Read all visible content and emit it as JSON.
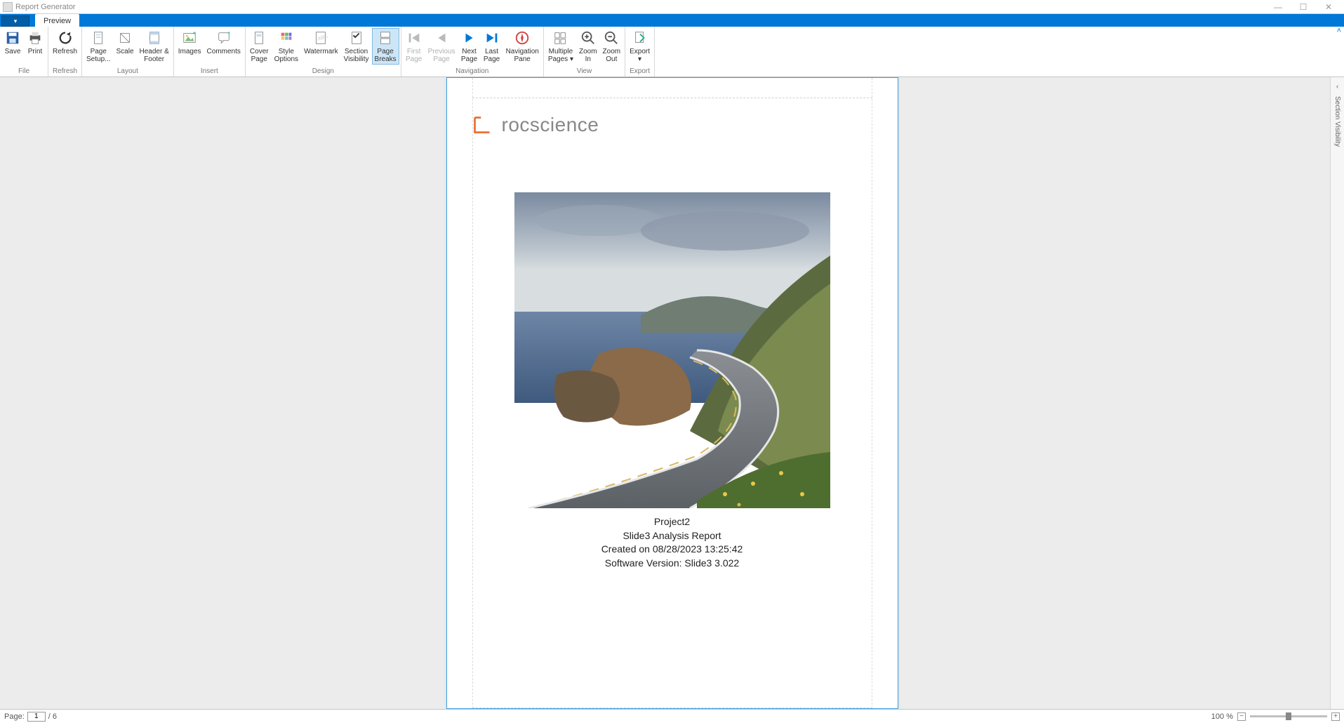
{
  "window": {
    "title": "Report Generator",
    "min": "—",
    "max": "☐",
    "close": "✕"
  },
  "tabs": {
    "preview": "Preview"
  },
  "ribbon": {
    "groups": {
      "file": "File",
      "refresh": "Refresh",
      "layout": "Layout",
      "insert": "Insert",
      "design": "Design",
      "navigation": "Navigation",
      "view": "View",
      "export": "Export"
    },
    "buttons": {
      "save": "Save",
      "print": "Print",
      "refresh": "Refresh",
      "page_setup": "Page\nSetup...",
      "scale": "Scale",
      "header_footer": "Header &\nFooter",
      "images": "Images",
      "comments": "Comments",
      "cover_page": "Cover\nPage",
      "style_options": "Style\nOptions",
      "watermark": "Watermark",
      "section_visibility": "Section\nVisibility",
      "page_breaks": "Page\nBreaks",
      "first_page": "First\nPage",
      "previous_page": "Previous\nPage",
      "next_page": "Next\nPage",
      "last_page": "Last\nPage",
      "navigation_pane": "Navigation\nPane",
      "multiple_pages": "Multiple\nPages ▾",
      "zoom_in": "Zoom\nIn",
      "zoom_out": "Zoom\nOut",
      "export": "Export\n▾"
    }
  },
  "sidepanel": {
    "label": "Section Visibility"
  },
  "document": {
    "logo_text": "rocscience",
    "lines": {
      "project": "Project2",
      "report": "Slide3 Analysis Report",
      "created": "Created on 08/28/2023 13:25:42",
      "version": "Software Version: Slide3 3.022"
    }
  },
  "statusbar": {
    "page_label": "Page:",
    "page_value": "1",
    "page_total": "/ 6",
    "zoom_label": "100 %"
  }
}
